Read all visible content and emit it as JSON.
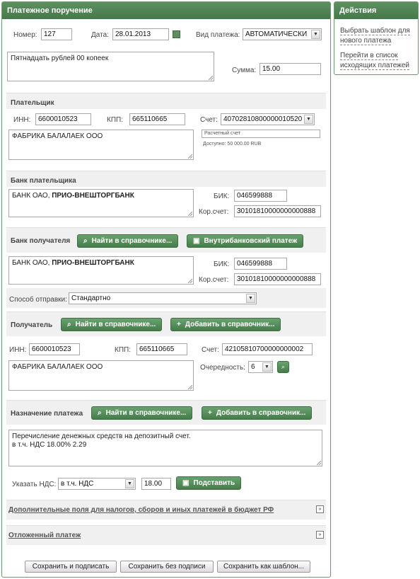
{
  "main": {
    "title": "Платежное поручение",
    "number_label": "Номер:",
    "number_value": "127",
    "date_label": "Дата:",
    "date_value": "28.01.2013",
    "payment_type_label": "Вид платежа:",
    "payment_type_value": "АВТОМАТИЧЕСКИ",
    "amount_words": "Пятнадцать рублей 00 копеек",
    "amount_label": "Сумма:",
    "amount_value": "15.00"
  },
  "payer": {
    "title": "Плательщик",
    "inn_label": "ИНН:",
    "inn_value": "6600010523",
    "kpp_label": "КПП:",
    "kpp_value": "665110665",
    "account_label": "Счет:",
    "account_value": "40702810800000010520",
    "name": "ФАБРИКА БАЛАЛАЕК ООО",
    "account_type": "Расчетный счет",
    "available": "Доступно: 50 000.00 RUB"
  },
  "payer_bank": {
    "title": "Банк плательщика",
    "name_prefix": "БАНК ОАО,",
    "name_bold": "ПРИО-ВНЕШТОРГБАНК",
    "bik_label": "БИК:",
    "bik_value": "046599888",
    "corr_label": "Кор.счет:",
    "corr_value": "30101810000000000888"
  },
  "recipient_bank": {
    "title": "Банк получателя",
    "find_button": "Найти в справочнике...",
    "internal_button": "Внутрибанковский платеж",
    "name_prefix": "БАНК ОАО,",
    "name_bold": "ПРИО-ВНЕШТОРГБАНК",
    "bik_label": "БИК:",
    "bik_value": "046599888",
    "corr_label": "Кор.счет:",
    "corr_value": "30101810000000000888",
    "send_method_label": "Способ отправки:",
    "send_method_value": "Стандартно"
  },
  "recipient": {
    "title": "Получатель",
    "find_button": "Найти в справочнике...",
    "add_button": "Добавить в справочник...",
    "inn_label": "ИНН:",
    "inn_value": "6600010523",
    "kpp_label": "КПП:",
    "kpp_value": "665110665",
    "account_label": "Счет:",
    "account_value": "42105810700000000002",
    "name": "ФАБРИКА БАЛАЛАЕК ООО",
    "priority_label": "Очередность:",
    "priority_value": "6"
  },
  "purpose": {
    "title": "Назначение платежа",
    "find_button": "Найти в справочнике...",
    "add_button": "Добавить в справочник...",
    "line1": "Перечисление денежных средств на депозитный счет.",
    "line2": "в т.ч. НДС 18.00% 2.29",
    "vat_label": "Указать НДС:",
    "vat_value": "в т.ч. НДС",
    "vat_rate": "18.00",
    "substitute_button": "Подставить"
  },
  "extra": {
    "budget_fields": "Дополнительные поля для налогов, сборов и иных платежей в бюджет РФ",
    "deferred": "Отложенный платеж"
  },
  "footer": {
    "save_sign": "Сохранить и подписать",
    "save_nosign": "Сохранить без подписи",
    "save_template": "Сохранить как шаблон..."
  },
  "actions": {
    "title": "Действия",
    "link1": "Выбрать шаблон для нового платежа",
    "link2": "Перейти в список исходящих платежей"
  },
  "icons": {
    "calendar": "calendar-icon",
    "search": "search-icon",
    "plus": "plus-icon",
    "internal": "bank-icon",
    "expand": "chevron-down-icon"
  }
}
